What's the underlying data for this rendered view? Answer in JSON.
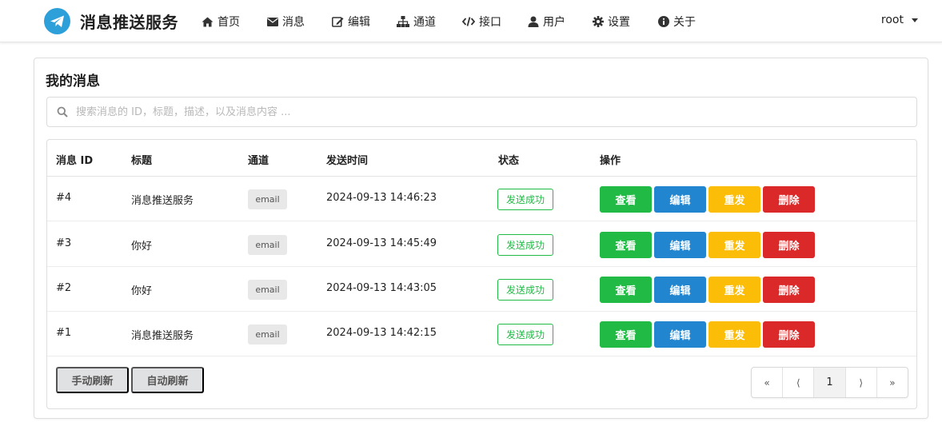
{
  "app": {
    "title": "消息推送服务",
    "colors": {
      "logo": "#2d9fd9",
      "success": "#21ba45",
      "primary": "#2185d0",
      "warning": "#fbbd08",
      "danger": "#db2828"
    }
  },
  "nav": {
    "items": [
      {
        "label": "首页",
        "icon": "home-icon"
      },
      {
        "label": "消息",
        "icon": "envelope-icon"
      },
      {
        "label": "编辑",
        "icon": "edit-icon"
      },
      {
        "label": "通道",
        "icon": "sitemap-icon"
      },
      {
        "label": "接口",
        "icon": "code-icon"
      },
      {
        "label": "用户",
        "icon": "user-icon"
      },
      {
        "label": "设置",
        "icon": "gear-icon"
      },
      {
        "label": "关于",
        "icon": "info-icon"
      }
    ],
    "user": "root"
  },
  "card": {
    "title": "我的消息",
    "search_placeholder": "搜索消息的 ID，标题，描述，以及消息内容 ..."
  },
  "table": {
    "headers": [
      "消息 ID",
      "标题",
      "通道",
      "发送时间",
      "状态",
      "操作"
    ],
    "rows": [
      {
        "id": "#4",
        "title": "消息推送服务",
        "channel": "email",
        "time": "2024-09-13 14:46:23",
        "status": "发送成功"
      },
      {
        "id": "#3",
        "title": "你好",
        "channel": "email",
        "time": "2024-09-13 14:45:49",
        "status": "发送成功"
      },
      {
        "id": "#2",
        "title": "你好",
        "channel": "email",
        "time": "2024-09-13 14:43:05",
        "status": "发送成功"
      },
      {
        "id": "#1",
        "title": "消息推送服务",
        "channel": "email",
        "time": "2024-09-13 14:42:15",
        "status": "发送成功"
      }
    ],
    "actions": {
      "view": "查看",
      "edit": "编辑",
      "resend": "重发",
      "delete": "删除"
    }
  },
  "footer": {
    "manual_refresh": "手动刷新",
    "auto_refresh": "自动刷新",
    "pagination": {
      "first": "«",
      "prev": "⟨",
      "current": "1",
      "next": "⟩",
      "last": "»"
    }
  }
}
